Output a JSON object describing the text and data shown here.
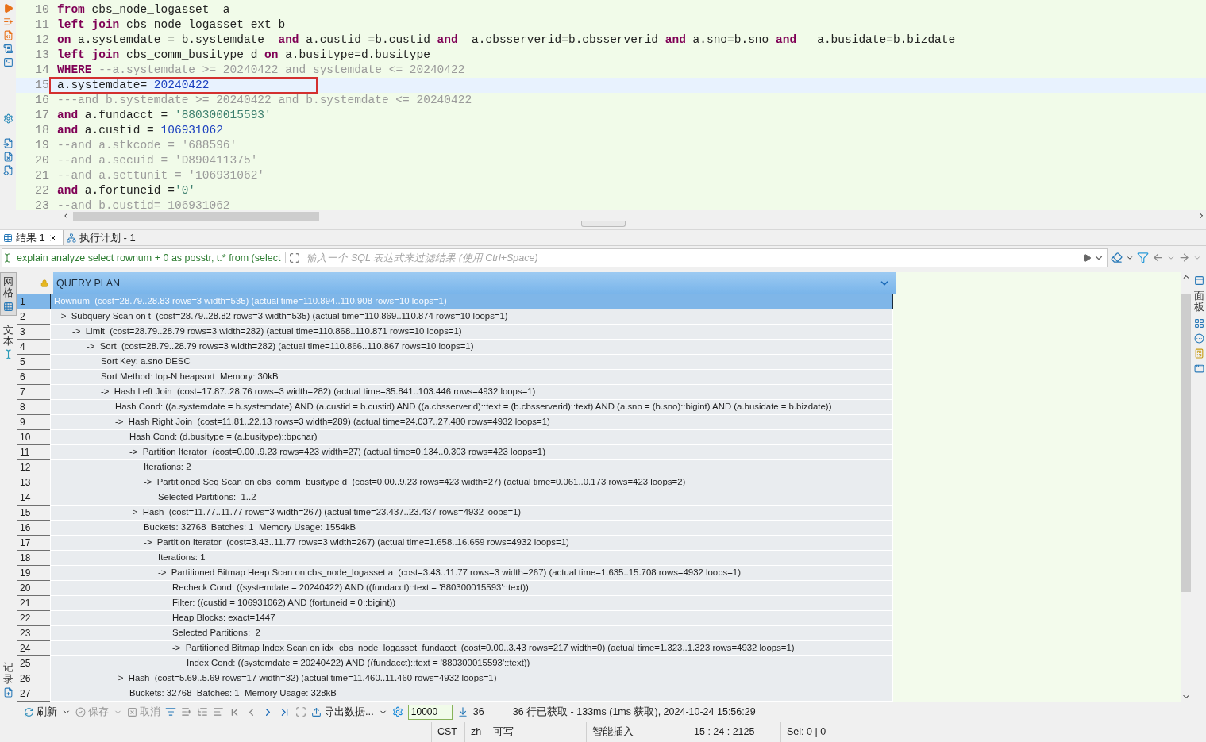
{
  "editor": {
    "lines": [
      {
        "number": "10",
        "current": false,
        "boxed": false,
        "tokens": [
          {
            "kind": "kw",
            "text": "from"
          },
          {
            "kind": "plain",
            "text": " cbs_node_logasset  a"
          }
        ]
      },
      {
        "number": "11",
        "current": false,
        "boxed": false,
        "tokens": [
          {
            "kind": "kw",
            "text": "left join"
          },
          {
            "kind": "plain",
            "text": " cbs_node_logasset_ext b"
          }
        ]
      },
      {
        "number": "12",
        "current": false,
        "boxed": false,
        "tokens": [
          {
            "kind": "kw",
            "text": "on"
          },
          {
            "kind": "plain",
            "text": " a.systemdate = b.systemdate  "
          },
          {
            "kind": "kw",
            "text": "and"
          },
          {
            "kind": "plain",
            "text": " a.custid =b.custid "
          },
          {
            "kind": "kw",
            "text": "and"
          },
          {
            "kind": "plain",
            "text": "  a.cbsserverid=b.cbsserverid "
          },
          {
            "kind": "kw",
            "text": "and"
          },
          {
            "kind": "plain",
            "text": " a.sno=b.sno "
          },
          {
            "kind": "kw",
            "text": "and"
          },
          {
            "kind": "plain",
            "text": "   a.busidate=b.bizdate"
          }
        ]
      },
      {
        "number": "13",
        "current": false,
        "boxed": false,
        "tokens": [
          {
            "kind": "kw",
            "text": "left join"
          },
          {
            "kind": "plain",
            "text": " cbs_comm_busitype d "
          },
          {
            "kind": "kw",
            "text": "on"
          },
          {
            "kind": "plain",
            "text": " a.busitype=d.busitype"
          }
        ]
      },
      {
        "number": "14",
        "current": false,
        "boxed": false,
        "tokens": [
          {
            "kind": "kw",
            "text": "WHERE"
          },
          {
            "kind": "comment",
            "text": " --a.systemdate >= 20240422 and systemdate <= 20240422"
          }
        ]
      },
      {
        "number": "15",
        "current": true,
        "boxed": true,
        "tokens": [
          {
            "kind": "plain",
            "text": "a.systemdate= "
          },
          {
            "kind": "num",
            "text": "20240422"
          }
        ]
      },
      {
        "number": "16",
        "current": false,
        "boxed": false,
        "tokens": [
          {
            "kind": "comment",
            "text": "---and b.systemdate >= 20240422 and b.systemdate <= 20240422"
          }
        ]
      },
      {
        "number": "17",
        "current": false,
        "boxed": false,
        "tokens": [
          {
            "kind": "kw",
            "text": "and"
          },
          {
            "kind": "plain",
            "text": " a.fundacct = "
          },
          {
            "kind": "str",
            "text": "'880300015593'"
          }
        ]
      },
      {
        "number": "18",
        "current": false,
        "boxed": false,
        "tokens": [
          {
            "kind": "kw",
            "text": "and"
          },
          {
            "kind": "plain",
            "text": " a.custid = "
          },
          {
            "kind": "num",
            "text": "106931062"
          }
        ]
      },
      {
        "number": "19",
        "current": false,
        "boxed": false,
        "tokens": [
          {
            "kind": "comment",
            "text": "--and a.stkcode = '688596'"
          }
        ]
      },
      {
        "number": "20",
        "current": false,
        "boxed": false,
        "tokens": [
          {
            "kind": "comment",
            "text": "--and a.secuid = 'D890411375'"
          }
        ]
      },
      {
        "number": "21",
        "current": false,
        "boxed": false,
        "tokens": [
          {
            "kind": "comment",
            "text": "--and a.settunit = '106931062'"
          }
        ]
      },
      {
        "number": "22",
        "current": false,
        "boxed": false,
        "tokens": [
          {
            "kind": "kw",
            "text": "and"
          },
          {
            "kind": "plain",
            "text": " a.fortuneid ="
          },
          {
            "kind": "str",
            "text": "'0'"
          }
        ]
      },
      {
        "number": "23",
        "current": false,
        "boxed": false,
        "tokens": [
          {
            "kind": "comment",
            "text": "--and b.custid= 106931062"
          }
        ]
      }
    ]
  },
  "result_tabs": [
    {
      "label": "结果 1",
      "selected": true,
      "closable": true
    },
    {
      "label": "执行计划 - 1",
      "selected": false,
      "closable": false
    }
  ],
  "filter_bar": {
    "query": "explain analyze select rownum + 0 as posstr, t.* from (select",
    "placeholder": "输入一个 SQL 表达式来过滤结果 (使用 Ctrl+Space)"
  },
  "view_tabs": [
    {
      "label": "网格",
      "selected": true
    },
    {
      "label": "文本",
      "selected": false
    }
  ],
  "record_tab": {
    "label": "记录"
  },
  "side_panel_tab": {
    "label": "面板"
  },
  "grid": {
    "column": "QUERY PLAN",
    "rows": [
      {
        "number": "1",
        "selected": true,
        "text": "Rownum  (cost=28.79..28.83 rows=3 width=535) (actual time=110.894..110.908 rows=10 loops=1)",
        "children": [
          {
            "number": "2",
            "selected": false,
            "text": "->  Subquery Scan on t  (cost=28.79..28.82 rows=3 width=535) (actual time=110.869..110.874 rows=10 loops=1)",
            "children": [
              {
                "number": "3",
                "selected": false,
                "text": "->  Limit  (cost=28.79..28.79 rows=3 width=282) (actual time=110.868..110.871 rows=10 loops=1)",
                "children": [
                  {
                    "number": "4",
                    "selected": false,
                    "text": "->  Sort  (cost=28.79..28.79 rows=3 width=282) (actual time=110.866..110.867 rows=10 loops=1)",
                    "children": [
                      {
                        "number": "5",
                        "selected": false,
                        "text": "Sort Key: a.sno DESC"
                      },
                      {
                        "number": "6",
                        "selected": false,
                        "text": "Sort Method: top-N heapsort  Memory: 30kB"
                      },
                      {
                        "number": "7",
                        "selected": false,
                        "text": "->  Hash Left Join  (cost=17.87..28.76 rows=3 width=282) (actual time=35.841..103.446 rows=4932 loops=1)",
                        "children": [
                          {
                            "number": "8",
                            "selected": false,
                            "text": "Hash Cond: ((a.systemdate = b.systemdate) AND (a.custid = b.custid) AND ((a.cbsserverid)::text = (b.cbsserverid)::text) AND (a.sno = (b.sno)::bigint) AND (a.busidate = b.bizdate))"
                          },
                          {
                            "number": "9",
                            "selected": false,
                            "text": "->  Hash Right Join  (cost=11.81..22.13 rows=3 width=289) (actual time=24.037..27.480 rows=4932 loops=1)",
                            "children": [
                              {
                                "number": "10",
                                "selected": false,
                                "text": "Hash Cond: (d.busitype = (a.busitype)::bpchar)"
                              },
                              {
                                "number": "11",
                                "selected": false,
                                "text": "->  Partition Iterator  (cost=0.00..9.23 rows=423 width=27) (actual time=0.134..0.303 rows=423 loops=1)",
                                "children": [
                                  {
                                    "number": "12",
                                    "selected": false,
                                    "text": "Iterations: 2"
                                  },
                                  {
                                    "number": "13",
                                    "selected": false,
                                    "text": "->  Partitioned Seq Scan on cbs_comm_busitype d  (cost=0.00..9.23 rows=423 width=27) (actual time=0.061..0.173 rows=423 loops=2)",
                                    "children": [
                                      {
                                        "number": "14",
                                        "selected": false,
                                        "text": "Selected Partitions:  1..2"
                                      }
                                    ]
                                  }
                                ]
                              },
                              {
                                "number": "15",
                                "selected": false,
                                "text": "->  Hash  (cost=11.77..11.77 rows=3 width=267) (actual time=23.437..23.437 rows=4932 loops=1)",
                                "children": [
                                  {
                                    "number": "16",
                                    "selected": false,
                                    "text": "Buckets: 32768  Batches: 1  Memory Usage: 1554kB"
                                  },
                                  {
                                    "number": "17",
                                    "selected": false,
                                    "text": "->  Partition Iterator  (cost=3.43..11.77 rows=3 width=267) (actual time=1.658..16.659 rows=4932 loops=1)",
                                    "children": [
                                      {
                                        "number": "18",
                                        "selected": false,
                                        "text": "Iterations: 1"
                                      },
                                      {
                                        "number": "19",
                                        "selected": false,
                                        "text": "->  Partitioned Bitmap Heap Scan on cbs_node_logasset a  (cost=3.43..11.77 rows=3 width=267) (actual time=1.635..15.708 rows=4932 loops=1)",
                                        "children": [
                                          {
                                            "number": "20",
                                            "selected": false,
                                            "text": "Recheck Cond: ((systemdate = 20240422) AND ((fundacct)::text = '880300015593'::text))"
                                          },
                                          {
                                            "number": "21",
                                            "selected": false,
                                            "text": "Filter: ((custid = 106931062) AND (fortuneid = 0::bigint))"
                                          },
                                          {
                                            "number": "22",
                                            "selected": false,
                                            "text": "Heap Blocks: exact=1447"
                                          },
                                          {
                                            "number": "23",
                                            "selected": false,
                                            "text": "Selected Partitions:  2"
                                          },
                                          {
                                            "number": "24",
                                            "selected": false,
                                            "text": "->  Partitioned Bitmap Index Scan on idx_cbs_node_logasset_fundacct  (cost=0.00..3.43 rows=217 width=0) (actual time=1.323..1.323 rows=4932 loops=1)",
                                            "children": [
                                              {
                                                "number": "25",
                                                "selected": false,
                                                "text": "Index Cond: ((systemdate = 20240422) AND ((fundacct)::text = '880300015593'::text))"
                                              }
                                            ]
                                          }
                                        ]
                                      }
                                    ]
                                  }
                                ]
                              }
                            ]
                          },
                          {
                            "number": "26",
                            "selected": false,
                            "text": "->  Hash  (cost=5.69..5.69 rows=17 width=32) (actual time=11.460..11.460 rows=4932 loops=1)",
                            "children": [
                              {
                                "number": "27",
                                "selected": false,
                                "text": "Buckets: 32768  Batches: 1  Memory Usage: 328kB"
                              }
                            ]
                          }
                        ]
                      }
                    ]
                  }
                ]
              }
            ]
          }
        ]
      }
    ]
  },
  "toolbar": {
    "refresh": {
      "label": "刷新",
      "disabled": false
    },
    "save": {
      "label": "保存",
      "disabled": true
    },
    "cancel": {
      "label": "取消",
      "disabled": true
    },
    "export": {
      "label": "导出数据..."
    },
    "fetch_size": "10000",
    "row_count": "36",
    "message": "36 行已获取 - 133ms (1ms 获取), 2024-10-24 15:56:29"
  },
  "status_bar": [
    "CST",
    "zh",
    "可写",
    "智能插入",
    "15 : 24 : 2125",
    "Sel: 0 | 0"
  ]
}
